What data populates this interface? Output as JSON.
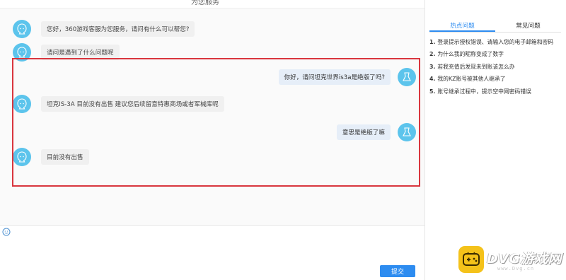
{
  "header": {
    "cut_title": "为您服务"
  },
  "messages": [
    {
      "side": "left",
      "text": "您好，360游戏客服为您服务，请问有什么可以帮您?"
    },
    {
      "side": "left",
      "text": "请问是遇到了什么问题呢"
    },
    {
      "side": "right",
      "text": "你好，请问坦克世界is3a是绝版了吗?"
    },
    {
      "side": "left",
      "text": "坦克IS-3A 目前没有出售  建议您后续留意特惠商场或者军械库呢"
    },
    {
      "side": "right",
      "text": "意思是绝版了嘛"
    },
    {
      "side": "left",
      "text": "目前没有出售"
    }
  ],
  "input": {
    "submit_label": "提交"
  },
  "side_panel": {
    "tabs": [
      {
        "label": "热点问题",
        "active": true
      },
      {
        "label": "常见问题",
        "active": false
      }
    ],
    "faq": [
      {
        "num": "1.",
        "text": "登录提示授权错误、请输入您的电子邮箱和密码"
      },
      {
        "num": "2.",
        "text": "为什么我的昵称变成了数字"
      },
      {
        "num": "3.",
        "text": "若我充值后发现未到账该怎么办"
      },
      {
        "num": "4.",
        "text": "我的KZ账号被其他人继承了"
      },
      {
        "num": "5.",
        "text": "账号继承过程中，提示空中网密码错误"
      }
    ]
  },
  "watermark": {
    "brand": "DVG游戏网",
    "sub": "www.Dvg.cn"
  },
  "colors": {
    "accent": "#2d8cf0",
    "avatar": "#5cc4ec",
    "highlight": "#d9363e",
    "logo": "#f4c21a"
  }
}
